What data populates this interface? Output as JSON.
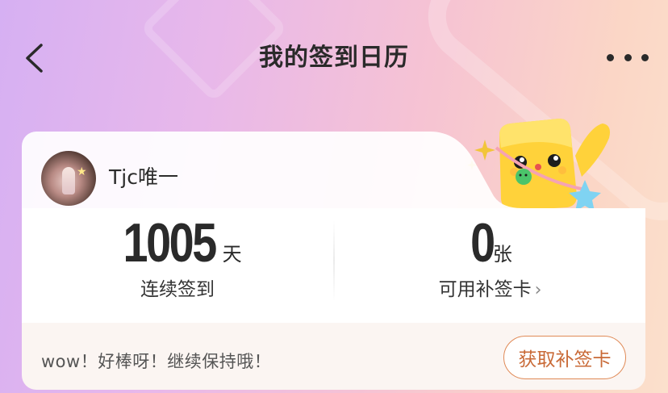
{
  "header": {
    "title": "我的签到日历",
    "back_icon": "chevron-left-icon",
    "more_icon": "more-horizontal-icon"
  },
  "profile": {
    "username": "Tjc唯一"
  },
  "stats": {
    "streak": {
      "value": "1005",
      "unit": "天",
      "label": "连续签到"
    },
    "makeup_cards": {
      "value": "0",
      "unit": "张",
      "label": "可用补签卡",
      "chevron": "›"
    }
  },
  "footer": {
    "message": "wow！好棒呀！继续保持哦！",
    "button_label": "获取补签卡"
  },
  "colors": {
    "accent": "#e08a57",
    "accent_text": "#c96a37",
    "footer_bg": "#fbf5f2"
  }
}
